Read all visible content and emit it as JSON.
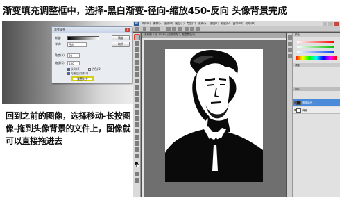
{
  "caption_top": "渐变填充调整框中，选择-黑白渐变-径向-缩放450-反向 头像背景完成",
  "caption_bottom": "回到之前的图像，选择移动-长按图像-拖到头像背景的文件上，图像就可以直接拖进去",
  "dialog": {
    "title": "渐变填充",
    "gradient_label": "渐变:",
    "style_label": "样式:",
    "style_value": "径向",
    "angle_label": "角度(A):",
    "angle_value": "90",
    "scale_label": "缩放(S):",
    "scale_value": "450",
    "reverse_label": "反向(R)",
    "dither_label": "仿色(D)",
    "align_label": "与图层对齐(L)",
    "ok_label": "确定",
    "cancel_label": "取消",
    "reset_label": "重置对齐"
  },
  "photoshop": {
    "menus": [
      "文件(F)",
      "编辑(E)",
      "图像(I)",
      "图层(L)",
      "类型(Y)",
      "选择(S)",
      "滤镜(T)",
      "视图(V)",
      "窗口(W)",
      "帮助(H)"
    ],
    "doc_tab": "未标题-1 @ 33.3% (渐变填充 1, 图层蒙版/8)",
    "panel_tabs": [
      "颜色",
      "色板",
      "调整",
      "样式",
      "图层",
      "通道",
      "路径"
    ],
    "layers": [
      "渐变填充 1",
      "背景"
    ]
  }
}
